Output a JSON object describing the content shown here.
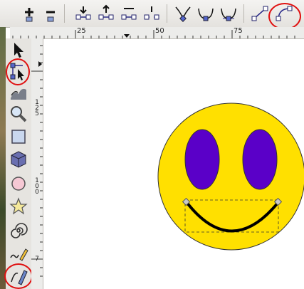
{
  "toolbar": {
    "buttons": [
      {
        "name": "add-node-icon"
      },
      {
        "name": "delete-node-icon"
      },
      {
        "name": "join-nodes-icon"
      },
      {
        "name": "break-path-icon"
      },
      {
        "name": "join-segment-icon"
      },
      {
        "name": "delete-segment-icon"
      },
      {
        "name": "node-cusp-icon"
      },
      {
        "name": "node-smooth-icon"
      },
      {
        "name": "node-symmetric-icon"
      },
      {
        "name": "segment-line-icon"
      },
      {
        "name": "segment-curve-icon"
      }
    ]
  },
  "ruler": {
    "top_labels": [
      "25",
      "50",
      "75"
    ],
    "left_labels": [
      "1",
      "2",
      "5",
      "1",
      "0",
      "0",
      "7"
    ]
  },
  "toolbox": {
    "tools": [
      "selector-tool-icon",
      "node-editor-tool-icon",
      "tweak-tool-icon",
      "zoom-tool-icon",
      "rectangle-tool-icon",
      "3d-box-tool-icon",
      "ellipse-tool-icon",
      "star-tool-icon",
      "spiral-tool-icon",
      "pencil-tool-icon",
      "pen-tool-icon"
    ]
  },
  "colors": {
    "face_fill": "#ffe000",
    "eye_fill": "#5a00c8",
    "highlight": "#e01010",
    "selection": "#4040c0"
  }
}
